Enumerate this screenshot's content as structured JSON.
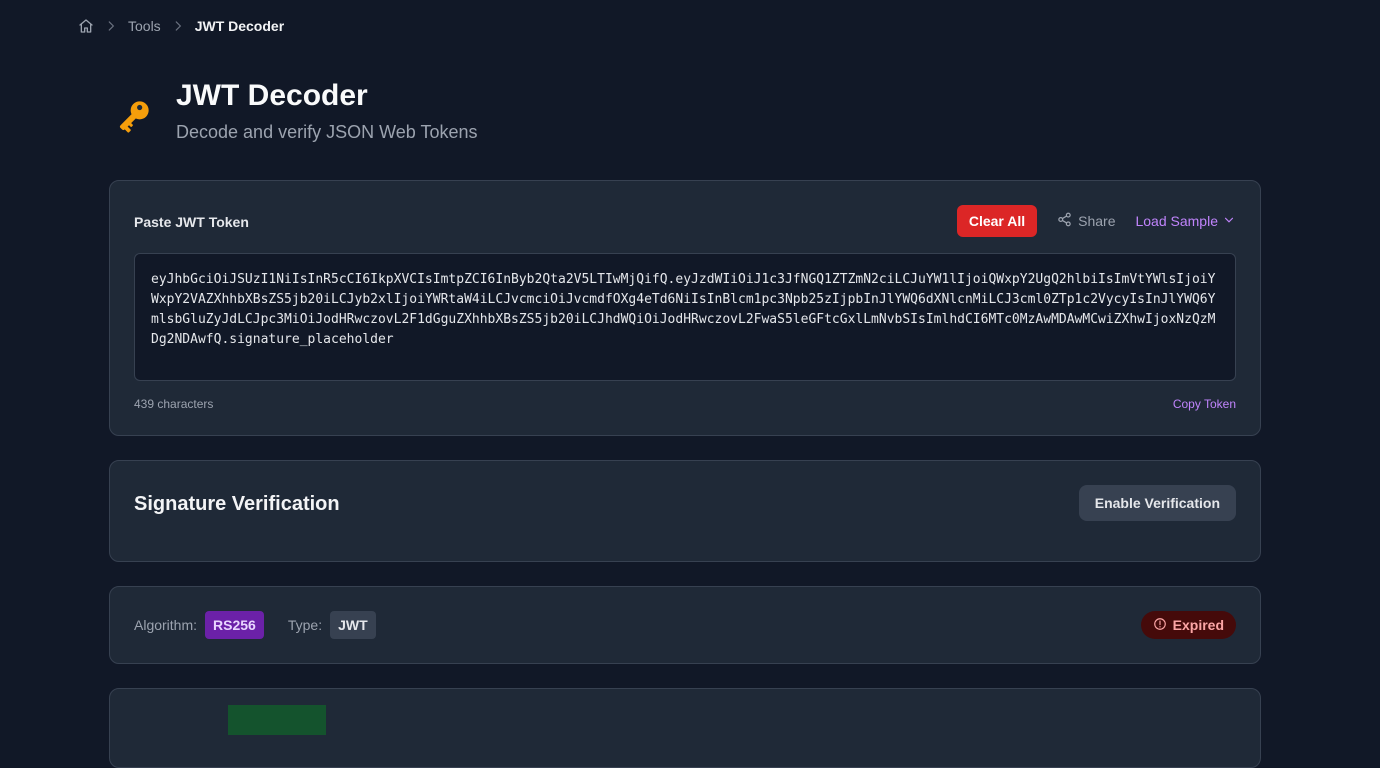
{
  "breadcrumb": {
    "home_icon": "home-icon",
    "tools": "Tools",
    "current": "JWT Decoder"
  },
  "header": {
    "icon": "key-icon",
    "title": "JWT Decoder",
    "subtitle": "Decode and verify JSON Web Tokens"
  },
  "token": {
    "label": "Paste JWT Token",
    "clear_label": "Clear All",
    "share_label": "Share",
    "sample_label": "Load Sample",
    "value": "eyJhbGciOiJSUzI1NiIsInR5cCI6IkpXVCIsImtpZCI6InByb2Qta2V5LTIwMjQifQ.eyJzdWIiOiJ1c3JfNGQ1ZTZmN2ciLCJuYW1lIjoiQWxpY2UgQ2hlbiIsImVtYWlsIjoiYWxpY2VAZXhhbXBsZS5jb20iLCJyb2xlIjoiYWRtaW4iLCJvcmciOiJvcmdfOXg4eTd6NiIsInBlcm1pc3Npb25zIjpbInJlYWQ6dXNlcnMiLCJ3cml0ZTp1c2VycyIsInJlYWQ6YmlsbGluZyJdLCJpc3MiOiJodHRwczovL2F1dGguZXhhbXBsZS5jb20iLCJhdWQiOiJodHRwczovL2FwaS5leGFtcGxlLmNvbSIsImlhdCI6MTc0MzAwMDAwMCwiZXhwIjoxNzQzMDg2NDAwfQ.signature_placeholder",
    "char_count": "439 characters",
    "copy_label": "Copy Token"
  },
  "verification": {
    "title": "Signature Verification",
    "enable_label": "Enable Verification"
  },
  "meta": {
    "algorithm_label": "Algorithm:",
    "algorithm_value": "RS256",
    "type_label": "Type:",
    "type_value": "JWT",
    "status": "Expired",
    "status_icon": "alert-circle-icon"
  },
  "colors": {
    "background": "#111827",
    "card": "#1f2937",
    "accent": "#c084fc",
    "danger": "#dc2626",
    "algorithm_badge": "#6b21a8",
    "expired_badge": "#450a0a"
  }
}
